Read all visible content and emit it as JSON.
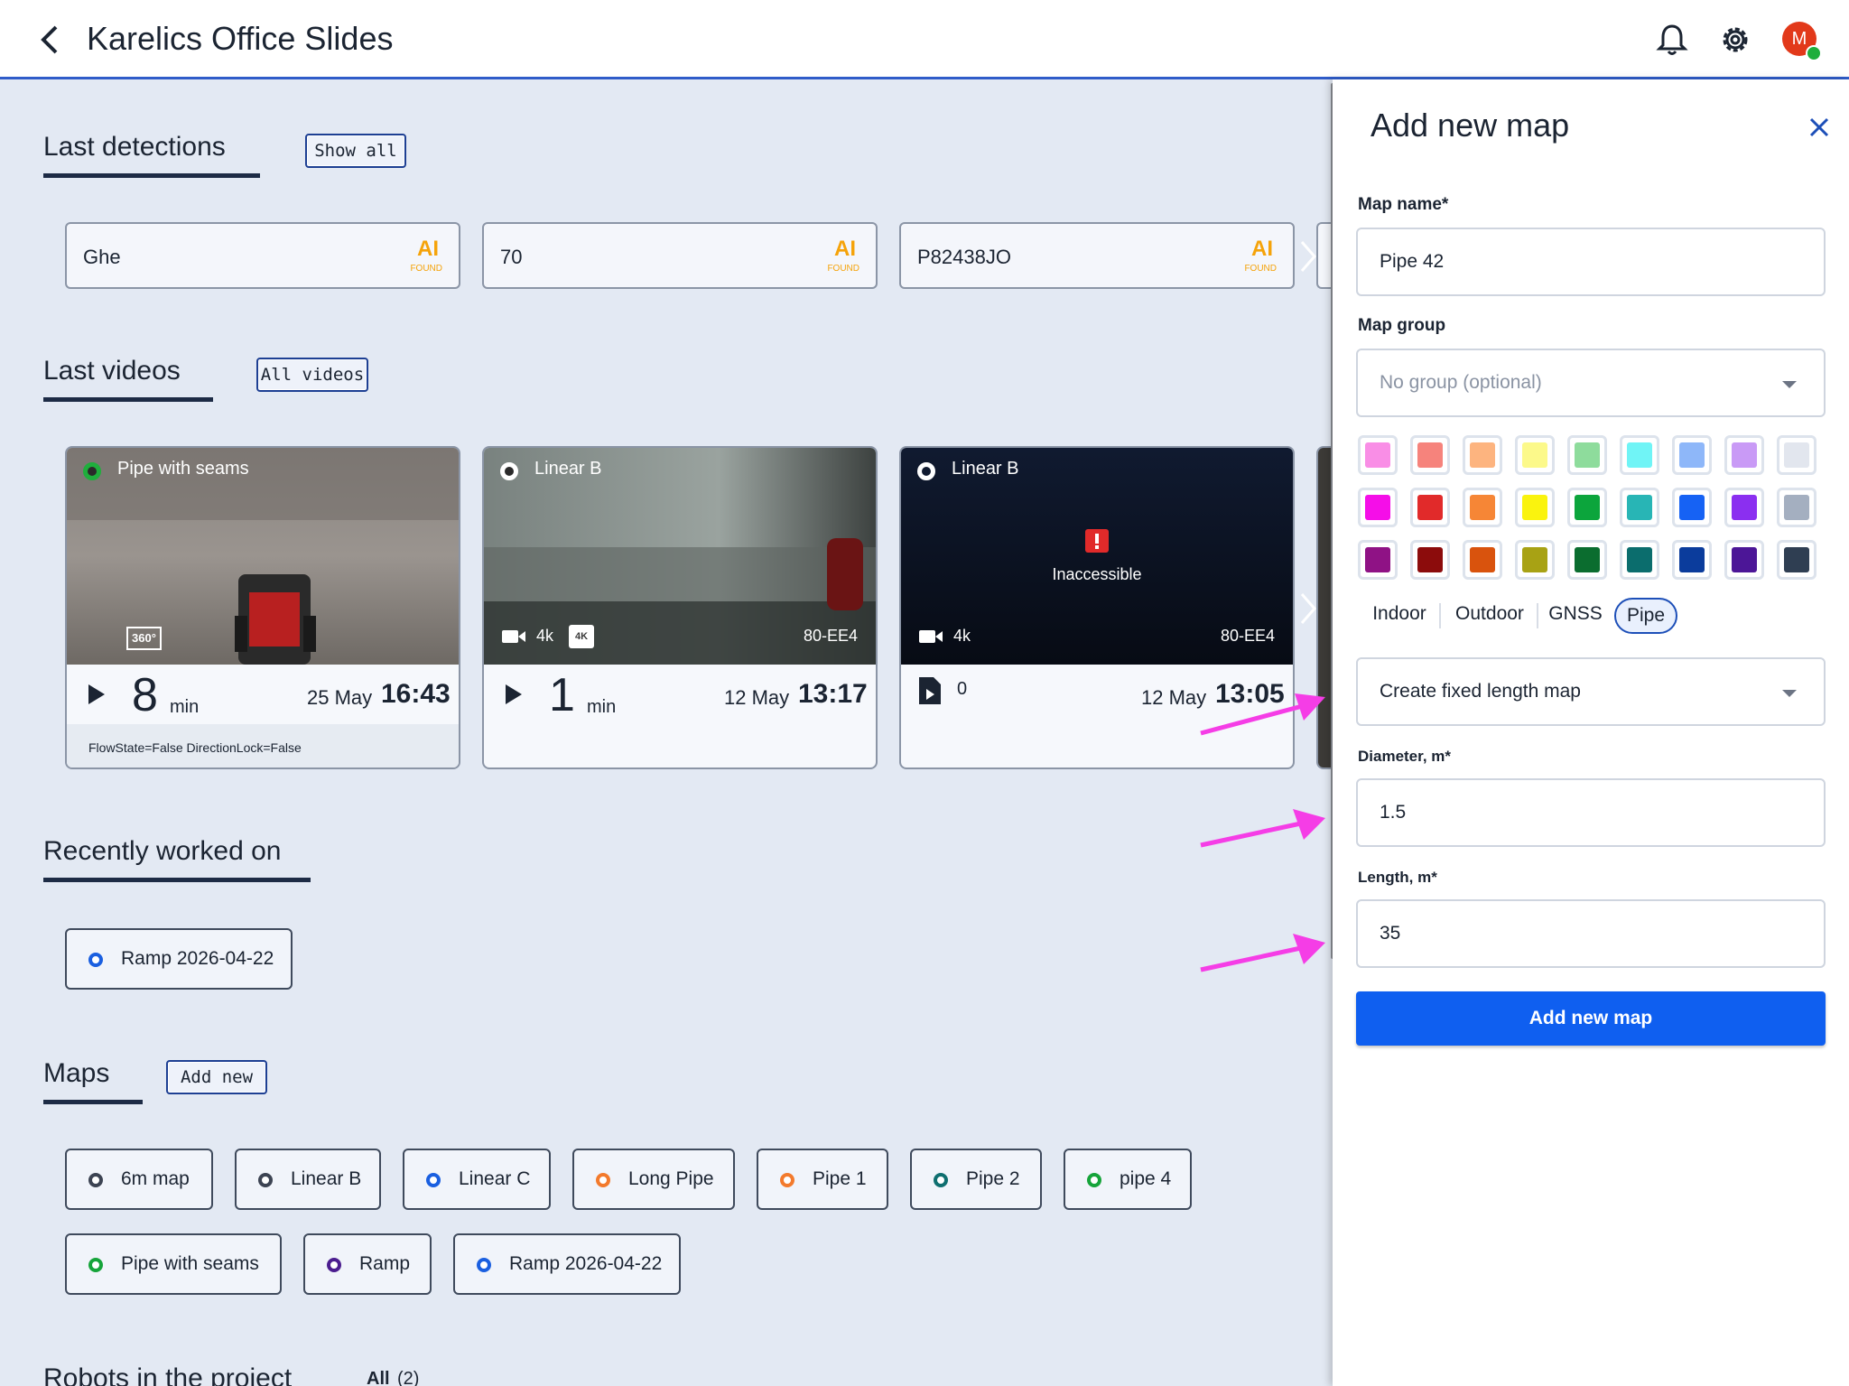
{
  "header": {
    "title": "Karelics Office Slides",
    "avatar_initial": "M"
  },
  "detections": {
    "title": "Last detections",
    "show_all": "Show all",
    "items": [
      {
        "text": "Ghe",
        "badge": "AI",
        "badge_sub": "FOUND"
      },
      {
        "text": "70",
        "badge": "AI",
        "badge_sub": "FOUND"
      },
      {
        "text": "P82438JO",
        "badge": "AI",
        "badge_sub": "FOUND"
      }
    ]
  },
  "videos": {
    "title": "Last videos",
    "all_videos": "All videos",
    "items": [
      {
        "title": "Pipe with seams",
        "badge": "360°",
        "duration": "8",
        "unit": "min",
        "date": "25 May",
        "time": "16:43",
        "flags": "FlowState=False DirectionLock=False"
      },
      {
        "title": "Linear B",
        "res": "4k",
        "res_badge": "4K",
        "robot": "80-EE4",
        "duration": "1",
        "unit": "min",
        "date": "12 May",
        "time": "13:17"
      },
      {
        "title": "Linear B",
        "status": "Inaccessible",
        "res": "4k",
        "robot": "80-EE4",
        "count": "0",
        "date": "12 May",
        "time": "13:05"
      }
    ]
  },
  "recent": {
    "title": "Recently worked on",
    "items": [
      {
        "label": "Ramp 2026-04-22",
        "color": "#1a5fe0"
      }
    ]
  },
  "maps": {
    "title": "Maps",
    "add_new": "Add new",
    "items": [
      {
        "label": "6m map",
        "color": "#3c4352"
      },
      {
        "label": "Linear B",
        "color": "#3c4352"
      },
      {
        "label": "Linear C",
        "color": "#1a5fe0"
      },
      {
        "label": "Long Pipe",
        "color": "#f37a2c"
      },
      {
        "label": "Pipe 1",
        "color": "#f37a2c"
      },
      {
        "label": "Pipe 2",
        "color": "#0f6f70"
      },
      {
        "label": "pipe 4",
        "color": "#16a43a"
      },
      {
        "label": "Pipe with seams",
        "color": "#16a43a"
      },
      {
        "label": "Ramp",
        "color": "#4b1d8f"
      },
      {
        "label": "Ramp 2026-04-22",
        "color": "#1a5fe0"
      }
    ]
  },
  "robots": {
    "title": "Robots in the project",
    "filter": "All",
    "count": "(2)"
  },
  "panel": {
    "title": "Add new map",
    "map_name_label": "Map name*",
    "map_name_value": "Pipe 42",
    "map_group_label": "Map group",
    "map_group_placeholder": "No group (optional)",
    "colors": [
      "#f98ee6",
      "#f6837c",
      "#fdb47f",
      "#fcf98a",
      "#8edc9c",
      "#70f4f6",
      "#8eb7f9",
      "#c99af6",
      "#e2e6ee",
      "#f50ee8",
      "#e12a2a",
      "#f68636",
      "#faf30e",
      "#0ca53c",
      "#28b5b5",
      "#1662f4",
      "#8b2ff0",
      "#a4afc0",
      "#8f1285",
      "#8c0c0c",
      "#d9530d",
      "#a8a214",
      "#0b6d2f",
      "#0b6d6d",
      "#0b3c9c",
      "#4c1697",
      "#2f3e52"
    ],
    "types": [
      "Indoor",
      "Outdoor",
      "GNSS",
      "Pipe"
    ],
    "selected_type": "Pipe",
    "mode_value": "Create fixed length map",
    "diameter_label": "Diameter, m*",
    "diameter_value": "1.5",
    "length_label": "Length, m*",
    "length_value": "35",
    "submit": "Add new map"
  }
}
